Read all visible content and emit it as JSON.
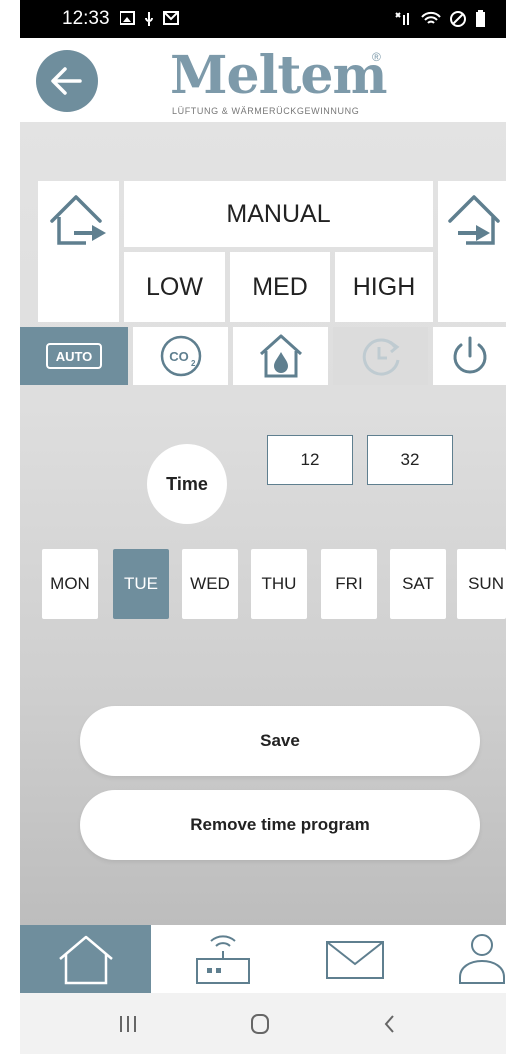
{
  "status_bar": {
    "time": "12:33"
  },
  "header": {
    "logo_text": "Meltem",
    "logo_tagline": "LÜFTUNG & WÄRMERÜCKGEWINNUNG",
    "logo_registered": "®"
  },
  "mode": {
    "title": "MANUAL",
    "speeds": [
      "LOW",
      "MED",
      "HIGH"
    ]
  },
  "function_tiles": [
    {
      "icon": "auto-icon",
      "label": "AUTO",
      "selected": true
    },
    {
      "icon": "co2-icon",
      "label": "CO2",
      "selected": false
    },
    {
      "icon": "humidity-house-icon",
      "selected": false
    },
    {
      "icon": "timer-icon",
      "selected": false,
      "disabled": true
    },
    {
      "icon": "power-icon",
      "selected": false
    }
  ],
  "time": {
    "label": "Time",
    "hour": "12",
    "minute": "32"
  },
  "days": {
    "items": [
      "MON",
      "TUE",
      "WED",
      "THU",
      "FRI",
      "SAT",
      "SUN"
    ],
    "selected": "TUE"
  },
  "actions": {
    "save_label": "Save",
    "remove_label": "Remove time program"
  },
  "tabbar": {
    "items": [
      "home-icon",
      "router-icon",
      "mail-icon",
      "user-icon"
    ],
    "active": "home-icon"
  },
  "colors": {
    "accent": "#6f8e9d",
    "background_top": "#e3e3e3",
    "background_bottom": "#bdbdbd"
  }
}
